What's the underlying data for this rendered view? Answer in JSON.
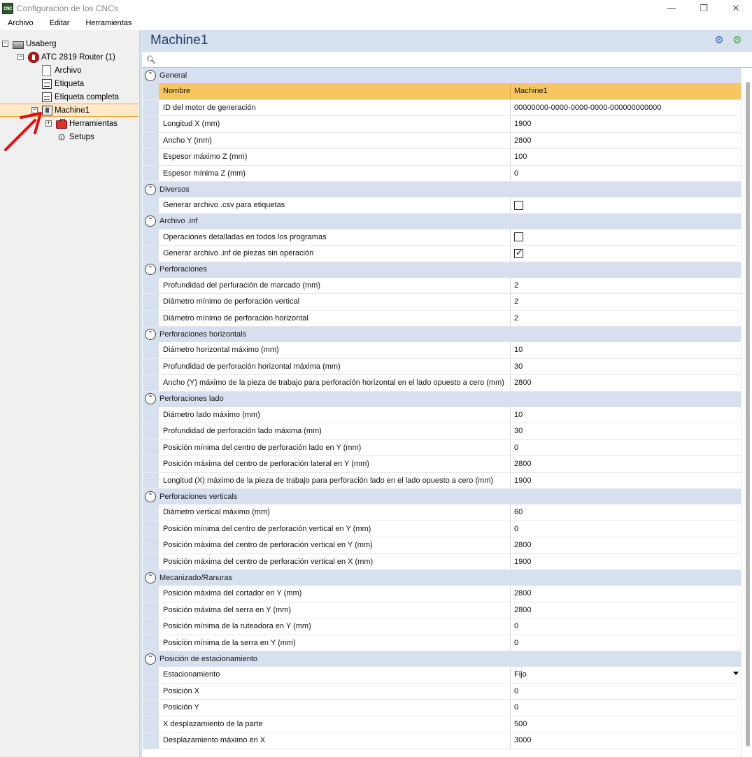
{
  "window": {
    "title": "Configuración de los CNCs",
    "app_icon": "CNC"
  },
  "menu": [
    "Archivo",
    "Editar",
    "Herramientas"
  ],
  "tree": [
    {
      "label": "Usaberg",
      "name": "tree-usaberg",
      "icon": "usaberg",
      "level": 0,
      "expander": "−"
    },
    {
      "label": "ATC 2819 Router (1)",
      "name": "tree-atc-router",
      "icon": "router",
      "level": 1,
      "expander": "−"
    },
    {
      "label": "Archivo",
      "name": "tree-archivo",
      "icon": "doc",
      "level": 2
    },
    {
      "label": "Etiqueta",
      "name": "tree-etiqueta",
      "icon": "label",
      "level": 2
    },
    {
      "label": "Etiqueta completa",
      "name": "tree-etiqueta-completa",
      "icon": "label",
      "level": 2
    },
    {
      "label": "Machine1",
      "name": "tree-machine1",
      "icon": "machine",
      "level": 2,
      "expander": "−",
      "selected": true
    },
    {
      "label": "Herramientas",
      "name": "tree-herramientas",
      "icon": "tools",
      "level": 3,
      "expander": "+"
    },
    {
      "label": "Setups",
      "name": "tree-setups",
      "icon": "gear",
      "level": 3
    }
  ],
  "panel": {
    "title": "Machine1",
    "highlight_color": "#f7c662",
    "header_color": "#d6e0ee"
  },
  "categories": [
    {
      "label": "General",
      "rows": [
        {
          "name": "Nombre",
          "value": "Machine1",
          "highlight": true
        },
        {
          "name": "ID del motor de generación",
          "value": "00000000-0000-0000-0000-000000000000"
        },
        {
          "name": "Longitud X (mm)",
          "value": "1900"
        },
        {
          "name": "Ancho Y (mm)",
          "value": "2800"
        },
        {
          "name": "Espesor máximo Z (mm)",
          "value": "100"
        },
        {
          "name": "Espesor mínima Z (mm)",
          "value": "0"
        }
      ]
    },
    {
      "label": "Diversos",
      "rows": [
        {
          "name": "Generar archivo .csv para etiquetas",
          "checkbox": false
        }
      ]
    },
    {
      "label": "Archivo .inf",
      "rows": [
        {
          "name": "Operaciones detalladas en todos los programas",
          "checkbox": false
        },
        {
          "name": "Generar archivo .inf de piezas sin operación",
          "checkbox": true
        }
      ]
    },
    {
      "label": "Perforaciones",
      "rows": [
        {
          "name": "Profundidad del perfuración de marcado (mm)",
          "value": "2"
        },
        {
          "name": "Diámetro mínimo de perforación vertical",
          "value": "2"
        },
        {
          "name": "Diámetro mínimo de perforación horizontal",
          "value": "2"
        }
      ]
    },
    {
      "label": "Perforaciones horizontals",
      "rows": [
        {
          "name": "Diámetro horizontal máximo (mm)",
          "value": "10"
        },
        {
          "name": "Profundidad de perforación horizontal máxima (mm)",
          "value": "30"
        },
        {
          "name": "Ancho (Y) máximo de la pieza de trabajo para perforación horizontal en el lado opuesto a cero (mm)",
          "value": "2800"
        }
      ]
    },
    {
      "label": "Perforaciones lado",
      "rows": [
        {
          "name": "Diámetro lado máximo (mm)",
          "value": "10"
        },
        {
          "name": "Profundidad de perforación lado máxima (mm)",
          "value": "30"
        },
        {
          "name": "Posición mínima del centro de perforación lado en Y (mm)",
          "value": "0"
        },
        {
          "name": "Posición máxima del centro de perforación lateral en Y (mm)",
          "value": "2800"
        },
        {
          "name": "Longitud (X) máximo de la pieza de trabajo para perforación lado en el lado opuesto a cero (mm)",
          "value": "1900"
        }
      ]
    },
    {
      "label": "Perforaciones verticals",
      "rows": [
        {
          "name": "Diámetro vertical máximo (mm)",
          "value": "60"
        },
        {
          "name": "Posición mínima del centro de perforación vertical en Y (mm)",
          "value": "0"
        },
        {
          "name": "Posición máxima del centro de perforación vertical en Y (mm)",
          "value": "2800"
        },
        {
          "name": "Posición máxima del centro de perforación vertical en X (mm)",
          "value": "1900"
        }
      ]
    },
    {
      "label": "Mecanizado/Ranuras",
      "rows": [
        {
          "name": "Posición máxima del cortador en Y (mm)",
          "value": "2800"
        },
        {
          "name": "Posición máxima del serra en Y (mm)",
          "value": "2800"
        },
        {
          "name": "Posición mínima de la ruteadora en Y (mm)",
          "value": "0"
        },
        {
          "name": "Posición mínima de la serra en Y (mm)",
          "value": "0"
        }
      ]
    },
    {
      "label": "Posición de estacionamiento",
      "rows": [
        {
          "name": "Estacionamiento",
          "value": "Fijo",
          "dropdown": true
        },
        {
          "name": "Posición X",
          "value": "0"
        },
        {
          "name": "Posición Y",
          "value": "0"
        },
        {
          "name": "X desplazamiento de la parte",
          "value": "500"
        },
        {
          "name": "Desplazamiento máximo en X",
          "value": "3000"
        }
      ]
    }
  ]
}
